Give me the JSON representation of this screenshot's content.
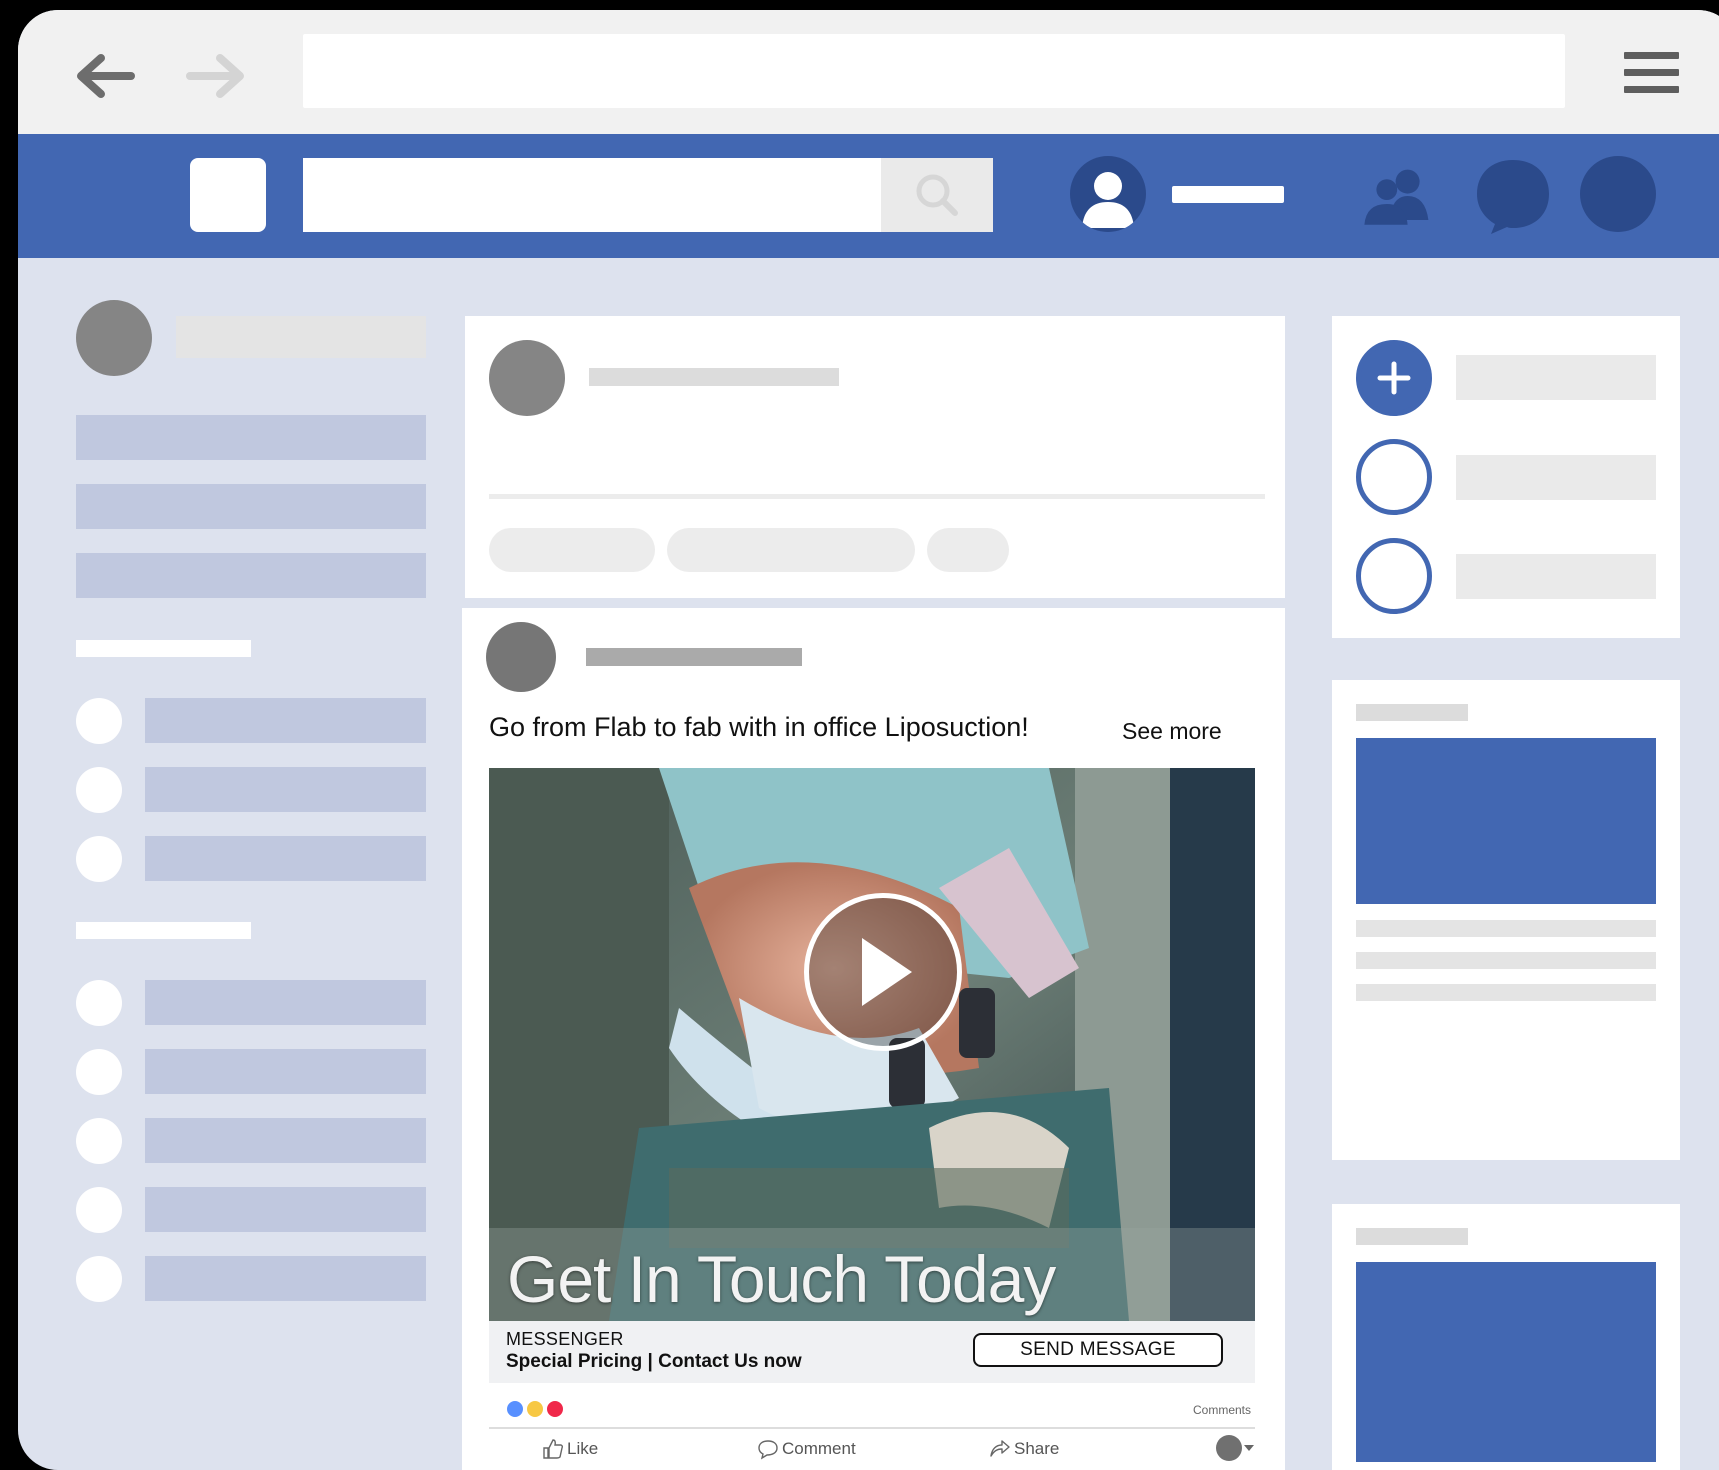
{
  "post": {
    "text": "Go from Flab to fab with in office Liposuction!",
    "see_more": "See more",
    "media_caption": "Get In Touch Today",
    "cta": {
      "subtitle": "MESSENGER",
      "title": "Special Pricing | Contact Us now",
      "button": "SEND MESSAGE"
    },
    "comments_label": "Comments",
    "actions": {
      "like": "Like",
      "comment": "Comment",
      "share": "Share"
    }
  },
  "colors": {
    "facebook_blue": "#4267b2",
    "page_background": "#dde2ee",
    "placeholder_lavender": "#c0c8df"
  },
  "icons": [
    "back-arrow-icon",
    "forward-arrow-icon",
    "hamburger-menu-icon",
    "search-icon",
    "user-avatar-icon",
    "friends-icon",
    "messenger-icon",
    "notifications-icon",
    "play-icon",
    "like-icon",
    "comment-icon",
    "share-icon",
    "plus-icon"
  ]
}
